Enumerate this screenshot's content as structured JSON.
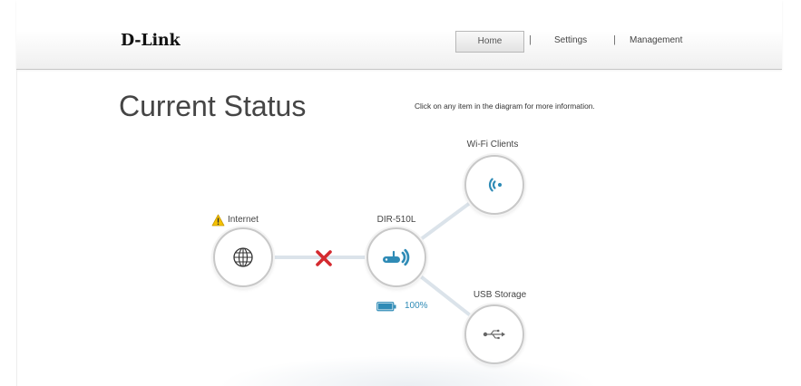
{
  "brand": {
    "logo_text": "D-Link"
  },
  "nav": {
    "separator": "|",
    "items": [
      {
        "label": "Home",
        "active": true
      },
      {
        "label": "Settings",
        "active": false
      },
      {
        "label": "Management",
        "active": false
      }
    ]
  },
  "page": {
    "title": "Current Status",
    "hint": "Click on any item in the diagram for more information."
  },
  "diagram": {
    "internet": {
      "label": "Internet",
      "icon": "globe-icon",
      "alert_icon": "warning-icon",
      "link_status_icon": "disconnected-x-icon"
    },
    "router": {
      "label": "DIR-510L",
      "icon": "router-icon",
      "battery_icon": "battery-icon",
      "battery_label": "100%",
      "battery_level": 1.0
    },
    "wifi_clients": {
      "label": "Wi-Fi Clients",
      "icon": "wifi-icon"
    },
    "usb_storage": {
      "label": "USB Storage",
      "icon": "usb-icon"
    }
  },
  "colors": {
    "accent": "#2f8bb6",
    "error": "#d42a2f",
    "warning": "#f5c200",
    "link_line": "#dbe3ea",
    "text": "#444444"
  }
}
